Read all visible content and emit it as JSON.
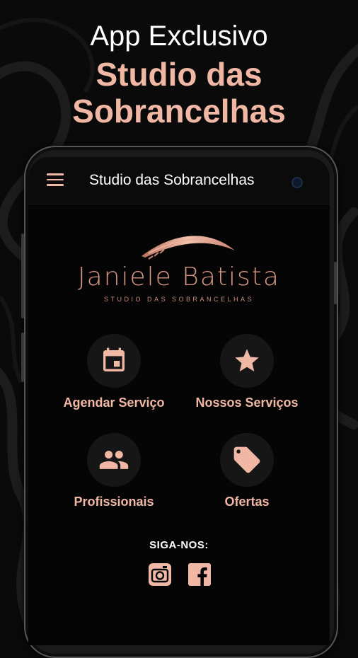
{
  "promo": {
    "line1": "App Exclusivo",
    "line2": "Studio das",
    "line3": "Sobrancelhas"
  },
  "appbar": {
    "title": "Studio das Sobrancelhas",
    "menu_icon": "hamburger-menu-icon"
  },
  "brand": {
    "name": "Janiele Batista",
    "subtitle": "STUDIO DAS SOBRANCELHAS"
  },
  "menu": [
    {
      "label": "Agendar Serviço",
      "icon": "calendar-icon"
    },
    {
      "label": "Nossos Serviços",
      "icon": "star-icon"
    },
    {
      "label": "Profissionais",
      "icon": "people-icon"
    },
    {
      "label": "Ofertas",
      "icon": "tags-icon"
    }
  ],
  "social": {
    "label": "SIGA-NOS:",
    "icons": [
      "instagram-icon",
      "facebook-icon"
    ]
  },
  "colors": {
    "accent": "#f0b8a4",
    "background": "#050505",
    "tile_bg": "#161616",
    "title_text": "#ffffff"
  }
}
